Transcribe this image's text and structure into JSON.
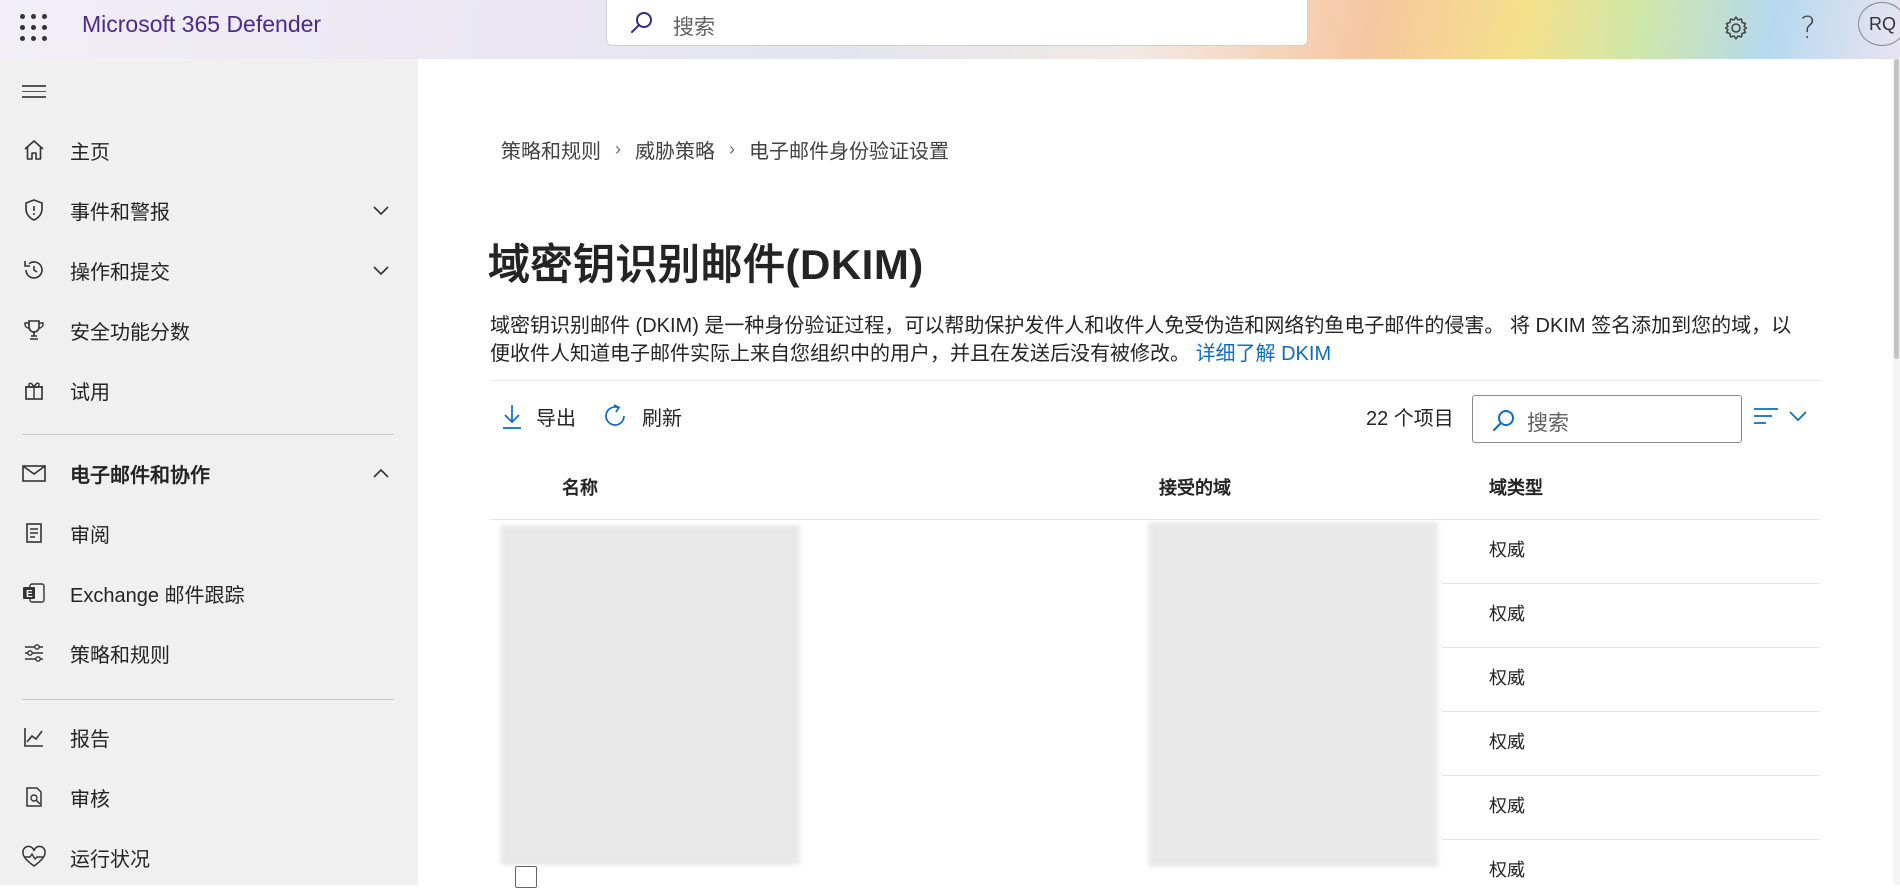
{
  "header": {
    "brand": "Microsoft 365 Defender",
    "search_placeholder": "搜索",
    "avatar_initials": "RQ"
  },
  "sidebar": {
    "items": [
      {
        "label": "主页",
        "icon": "home-icon"
      },
      {
        "label": "事件和警报",
        "icon": "shield-icon",
        "expandable": true
      },
      {
        "label": "操作和提交",
        "icon": "history-icon",
        "expandable": true
      },
      {
        "label": "安全功能分数",
        "icon": "trophy-icon"
      },
      {
        "label": "试用",
        "icon": "gift-icon"
      },
      {
        "label": "电子邮件和协作",
        "icon": "mail-icon",
        "expanded": true
      },
      {
        "label": "审阅",
        "icon": "document-icon"
      },
      {
        "label": "Exchange 邮件跟踪",
        "icon": "exchange-icon"
      },
      {
        "label": "策略和规则",
        "icon": "settings-sliders-icon"
      },
      {
        "label": "报告",
        "icon": "chart-icon"
      },
      {
        "label": "审核",
        "icon": "audit-icon"
      },
      {
        "label": "运行状况",
        "icon": "heart-pulse-icon"
      }
    ]
  },
  "breadcrumb": [
    "策略和规则",
    "威胁策略",
    "电子邮件身份验证设置"
  ],
  "page": {
    "title": "域密钥识别邮件(DKIM)",
    "description": "域密钥识别邮件 (DKIM) 是一种身份验证过程，可以帮助保护发件人和收件人免受伪造和网络钓鱼电子邮件的侵害。 将 DKIM 签名添加到您的域，以便收件人知道电子邮件实际上来自您组织中的用户，并且在发送后没有被修改。",
    "learn_more": "详细了解 DKIM"
  },
  "toolbar": {
    "export_label": "导出",
    "refresh_label": "刷新",
    "item_count": "22 个项目",
    "search_placeholder": "搜索"
  },
  "table": {
    "columns": [
      "名称",
      "接受的域",
      "域类型"
    ],
    "rows": [
      {
        "domain_type": "权威"
      },
      {
        "domain_type": "权威"
      },
      {
        "domain_type": "权威"
      },
      {
        "domain_type": "权威"
      },
      {
        "domain_type": "权威"
      },
      {
        "domain_type": "权威"
      }
    ]
  },
  "colors": {
    "brand_text": "#4b2a8c",
    "link": "#0f6cbd",
    "sidebar_bg": "#f0f0f0"
  }
}
